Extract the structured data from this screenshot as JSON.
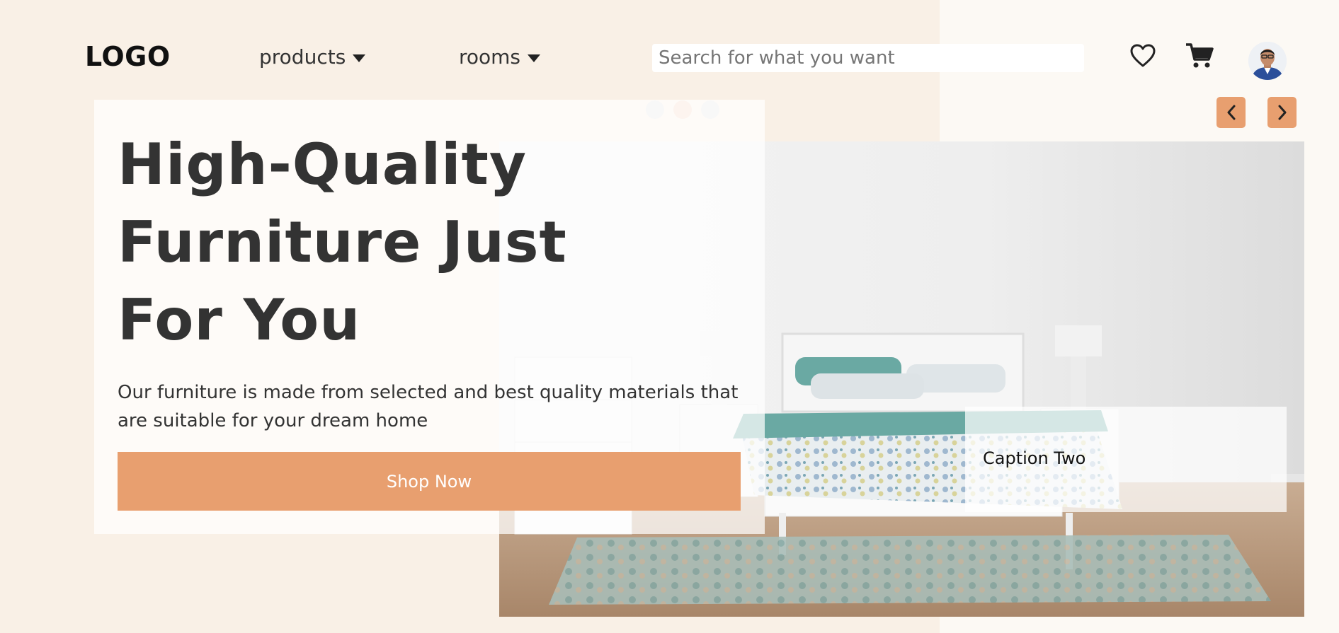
{
  "header": {
    "logo": "LOGO",
    "nav": [
      {
        "label": "products",
        "icon": "caret-down-icon"
      },
      {
        "label": "rooms",
        "icon": "caret-down-icon"
      }
    ],
    "search": {
      "placeholder": "Search for what you want",
      "value": ""
    },
    "icons": [
      "heart-icon",
      "cart-icon",
      "avatar"
    ]
  },
  "hero": {
    "title": "High-Quality Furniture Just For You",
    "subtitle": "Our furniture is made from selected and best quality materials that are suitable for your dream home",
    "cta_label": "Shop Now"
  },
  "carousel": {
    "active_index": 1,
    "dot_count": 3,
    "caption": "Caption Two",
    "prev_icon": "chevron-left-icon",
    "next_icon": "chevron-right-icon"
  },
  "colors": {
    "accent": "#e89f6f",
    "background_left": "#f9f0e6",
    "background_right": "#fcf9f4",
    "text": "#333333"
  }
}
